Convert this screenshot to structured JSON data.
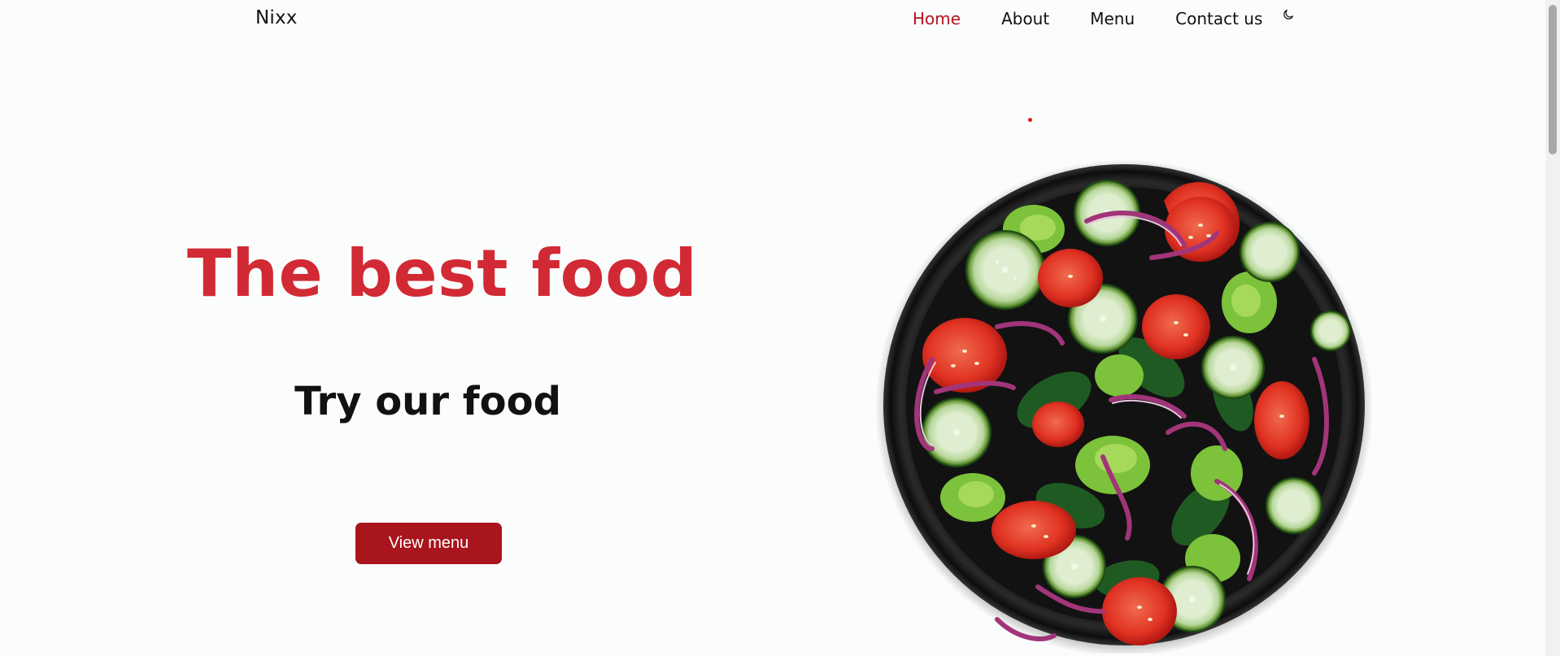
{
  "brand": "Nixx",
  "nav": {
    "items": [
      "Home",
      "About",
      "Menu",
      "Contact us"
    ],
    "active": "Home"
  },
  "hero": {
    "title": "The best food",
    "subtitle": "Try our food",
    "cta": "View menu"
  },
  "icons": {
    "theme_toggle": "moon-icon",
    "hero_image": "salad-plate"
  },
  "colors": {
    "accent": "#b3141c",
    "title": "#d22a34",
    "button": "#a8151c",
    "background": "#fbfdfd"
  }
}
